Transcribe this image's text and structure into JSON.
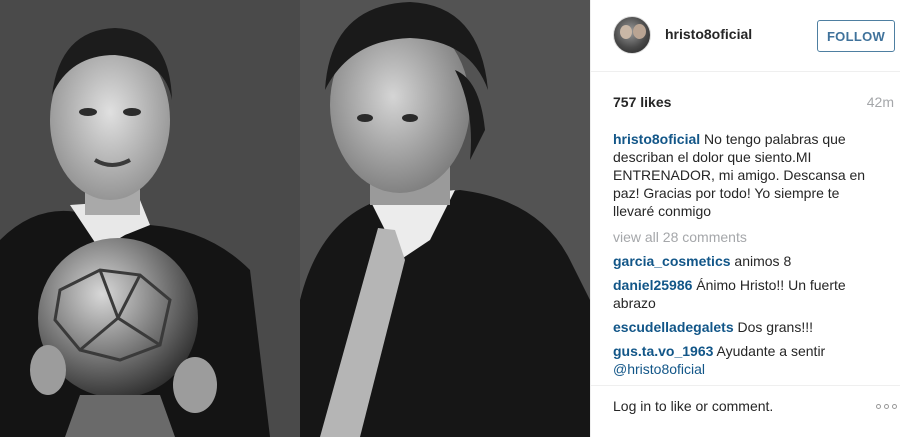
{
  "header": {
    "username": "hristo8oficial",
    "follow_label": "FOLLOW"
  },
  "stats": {
    "likes": "757 likes",
    "time": "42m"
  },
  "caption": {
    "username": "hristo8oficial",
    "text": "No tengo palabras que describan el dolor que siento.MI ENTRENADOR, mi amigo. Descansa en paz! Gracias por todo! Yo siempre te llevaré conmigo"
  },
  "view_all": "view all 28 comments",
  "comments": [
    {
      "username": "garcia_cosmetics",
      "text": "animos 8"
    },
    {
      "username": "daniel25986",
      "text": "Ánimo Hristo!! Un fuerte abrazo"
    },
    {
      "username": "escudelladegalets",
      "text": "Dos grans!!!"
    },
    {
      "username": "gus.ta.vo_1963",
      "text": "Ayudante a sentir",
      "mention": "@hristo8oficial"
    }
  ],
  "footer": {
    "login_text": "Log in to like or comment."
  },
  "icons": {
    "more": "more-options-icon"
  }
}
